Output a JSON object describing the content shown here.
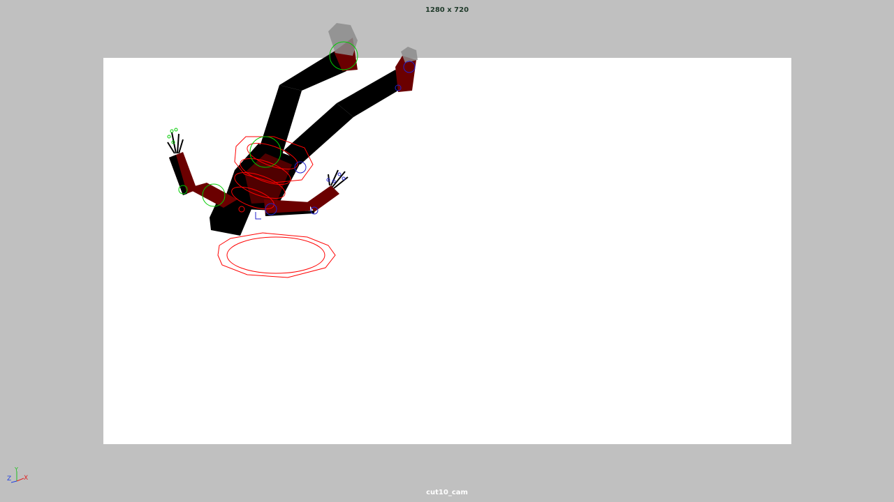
{
  "viewport": {
    "resolution_label": "1280 x 720",
    "camera_name": "cut10_cam",
    "background_color": "#c0c0c0",
    "gate_color": "#ffffff"
  },
  "scene": {
    "mesh_color": "#000000",
    "mesh_accent_color": "#6b0000",
    "control_color": "#ff0000",
    "joint_color_left": "#00cc00",
    "joint_color_right": "#2222cc"
  },
  "axis_gizmo": {
    "x_label": "X",
    "y_label": "Y",
    "z_label": "Z",
    "x_color": "#e02020",
    "y_color": "#20c020",
    "z_color": "#2040e0"
  }
}
